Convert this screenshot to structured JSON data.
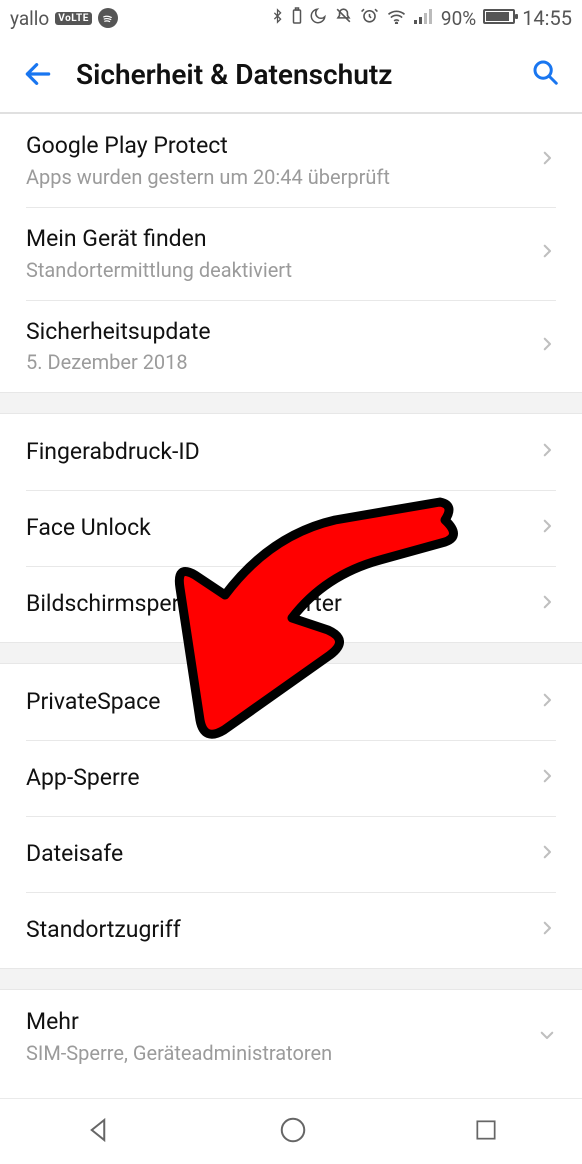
{
  "status": {
    "carrier": "yallo",
    "volte": "VoLTE",
    "battery_pct": "90%",
    "time": "14:55",
    "icons": [
      "bluetooth",
      "moon",
      "mute",
      "alarm",
      "wifi",
      "signal"
    ]
  },
  "header": {
    "title": "Sicherheit & Datenschutz"
  },
  "groups": [
    [
      {
        "label": "Google Play Protect",
        "sub": "Apps wurden gestern um 20:44 überprüft",
        "arrow": "right"
      },
      {
        "label": "Mein Gerät finden",
        "sub": "Standortermittlung deaktiviert",
        "arrow": "right"
      },
      {
        "label": "Sicherheitsupdate",
        "sub": "5. Dezember 2018",
        "arrow": "right"
      }
    ],
    [
      {
        "label": "Fingerabdruck-ID",
        "arrow": "right"
      },
      {
        "label": "Face Unlock",
        "arrow": "right"
      },
      {
        "label": "Bildschirmsperre & Passwörter",
        "arrow": "right"
      }
    ],
    [
      {
        "label": "PrivateSpace",
        "arrow": "right"
      },
      {
        "label": "App-Sperre",
        "arrow": "right"
      },
      {
        "label": "Dateisafe",
        "arrow": "right"
      },
      {
        "label": "Standortzugriff",
        "arrow": "right"
      }
    ],
    [
      {
        "label": "Mehr",
        "sub": "SIM-Sperre, Geräteadministratoren",
        "arrow": "down"
      }
    ]
  ],
  "annotation": {
    "arrow_color": "#ff0000",
    "arrow_target": "App-Sperre"
  }
}
